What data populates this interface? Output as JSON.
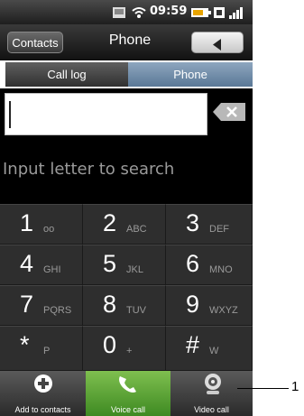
{
  "status_bar": {
    "time": "09:59"
  },
  "titlebar": {
    "contacts_label": "Contacts",
    "title": "Phone"
  },
  "tabs": [
    {
      "label": "Call log"
    },
    {
      "label": "Phone"
    }
  ],
  "search_hint": "Input letter to search",
  "keypad": [
    {
      "digit": "1",
      "letters": "oo"
    },
    {
      "digit": "2",
      "letters": "ABC"
    },
    {
      "digit": "3",
      "letters": "DEF"
    },
    {
      "digit": "4",
      "letters": "GHI"
    },
    {
      "digit": "5",
      "letters": "JKL"
    },
    {
      "digit": "6",
      "letters": "MNO"
    },
    {
      "digit": "7",
      "letters": "PQRS"
    },
    {
      "digit": "8",
      "letters": "TUV"
    },
    {
      "digit": "9",
      "letters": "WXYZ"
    },
    {
      "digit": "*",
      "letters": "P"
    },
    {
      "digit": "0",
      "letters": "+"
    },
    {
      "digit": "#",
      "letters": "W"
    }
  ],
  "actions": {
    "add_label": "Add to contacts",
    "voice_label": "Voice call",
    "video_label": "Video call"
  },
  "callout": "1",
  "colors": {
    "voice_call_green": "#4e9a2e",
    "phone_tab_blue": "#6f8aa8"
  },
  "icons": [
    "media-icon",
    "wifi-icon",
    "battery-icon",
    "sim-icon",
    "signal-icon",
    "back-arrow-icon",
    "backspace-icon",
    "add-icon",
    "phone-handset-icon",
    "video-camera-icon"
  ]
}
